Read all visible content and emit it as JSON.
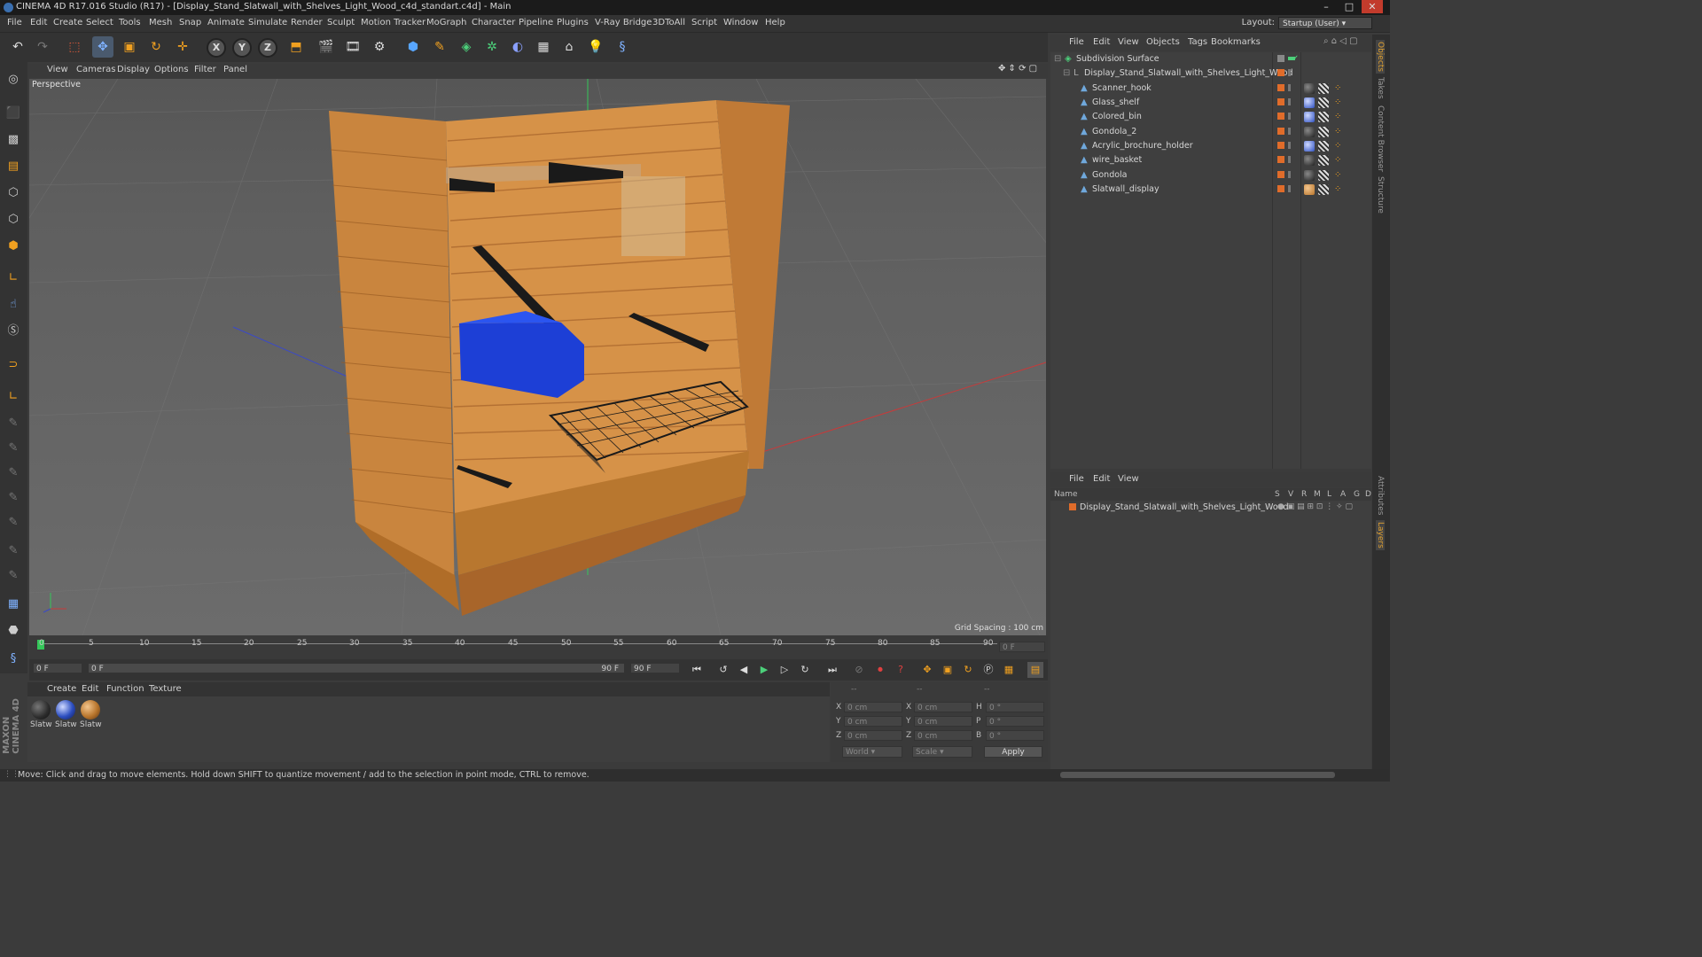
{
  "window": {
    "title": "CINEMA 4D R17.016 Studio (R17) - [Display_Stand_Slatwall_with_Shelves_Light_Wood_c4d_standart.c4d] - Main",
    "controls": [
      "–",
      "□",
      "✕"
    ]
  },
  "menubar": {
    "items": [
      "File",
      "Edit",
      "Create",
      "Select",
      "Tools",
      "Mesh",
      "Snap",
      "Animate",
      "Simulate",
      "Render",
      "Sculpt",
      "Motion Tracker",
      "MoGraph",
      "Character",
      "Pipeline",
      "Plugins",
      "V-Ray Bridge",
      "3DToAll",
      "Script",
      "Window",
      "Help"
    ],
    "layout_label": "Layout:",
    "layout_value": "Startup (User)"
  },
  "toolbar": {
    "axis_x": "X",
    "axis_y": "Y",
    "axis_z": "Z"
  },
  "viewport": {
    "menu": [
      "View",
      "Cameras",
      "Display",
      "Options",
      "Filter",
      "Panel"
    ],
    "label": "Perspective",
    "grid_spacing": "Grid Spacing : 100 cm",
    "colors": {
      "wood": "#c8883f",
      "bin": "#1d3fd6",
      "metal": "#1a1a1a"
    }
  },
  "timeline": {
    "ticks": [
      "0",
      "5",
      "10",
      "15",
      "20",
      "25",
      "30",
      "35",
      "40",
      "45",
      "50",
      "55",
      "60",
      "65",
      "70",
      "75",
      "80",
      "85",
      "90"
    ],
    "current_frame_right": "0 F",
    "start_field": "0 F",
    "range_start": "0 F",
    "range_end": "90 F",
    "end_field": "90 F"
  },
  "material_manager": {
    "menu": [
      "Create",
      "Edit",
      "Function",
      "Texture"
    ],
    "materials": [
      {
        "label": "Slatw",
        "color": "#2b2b2b"
      },
      {
        "label": "Slatw",
        "color": "#2c4ec0"
      },
      {
        "label": "Slatw",
        "color": "#b8752c"
      }
    ]
  },
  "coordinates": {
    "header": [
      "--",
      "--",
      "--"
    ],
    "rows": [
      {
        "a": "X",
        "av": "0 cm",
        "b": "X",
        "bv": "0 cm",
        "c": "H",
        "cv": "0 °"
      },
      {
        "a": "Y",
        "av": "0 cm",
        "b": "Y",
        "bv": "0 cm",
        "c": "P",
        "cv": "0 °"
      },
      {
        "a": "Z",
        "av": "0 cm",
        "b": "Z",
        "bv": "0 cm",
        "c": "B",
        "cv": "0 °"
      }
    ],
    "world": "World",
    "scale": "Scale",
    "apply": "Apply"
  },
  "object_manager": {
    "menu": [
      "File",
      "Edit",
      "View",
      "Objects",
      "Tags",
      "Bookmarks"
    ],
    "objects": [
      {
        "name": "Subdivision Surface",
        "level": 0
      },
      {
        "name": "Display_Stand_Slatwall_with_Shelves_Light_Wood",
        "level": 1
      },
      {
        "name": "Scanner_hook",
        "level": 2
      },
      {
        "name": "Glass_shelf",
        "level": 2
      },
      {
        "name": "Colored_bin",
        "level": 2
      },
      {
        "name": "Gondola_2",
        "level": 2
      },
      {
        "name": "Acrylic_brochure_holder",
        "level": 2
      },
      {
        "name": "wire_basket",
        "level": 2
      },
      {
        "name": "Gondola",
        "level": 2
      },
      {
        "name": "Slatwall_display",
        "level": 2
      }
    ]
  },
  "layer_manager": {
    "menu": [
      "File",
      "Edit",
      "View"
    ],
    "columns": [
      "Name",
      "S",
      "V",
      "R",
      "M",
      "L",
      "A",
      "G",
      "D"
    ],
    "layers": [
      "Display_Stand_Slatwall_with_Shelves_Light_Wood"
    ]
  },
  "right_tabs": [
    "Objects",
    "Takes",
    "Content Browser",
    "Structure",
    "Attributes",
    "Layers"
  ],
  "status": "Move: Click and drag to move elements. Hold down SHIFT to quantize movement / add to the selection in point mode, CTRL to remove.",
  "logo": {
    "line1": "MAXON",
    "line2": "CINEMA 4D"
  }
}
